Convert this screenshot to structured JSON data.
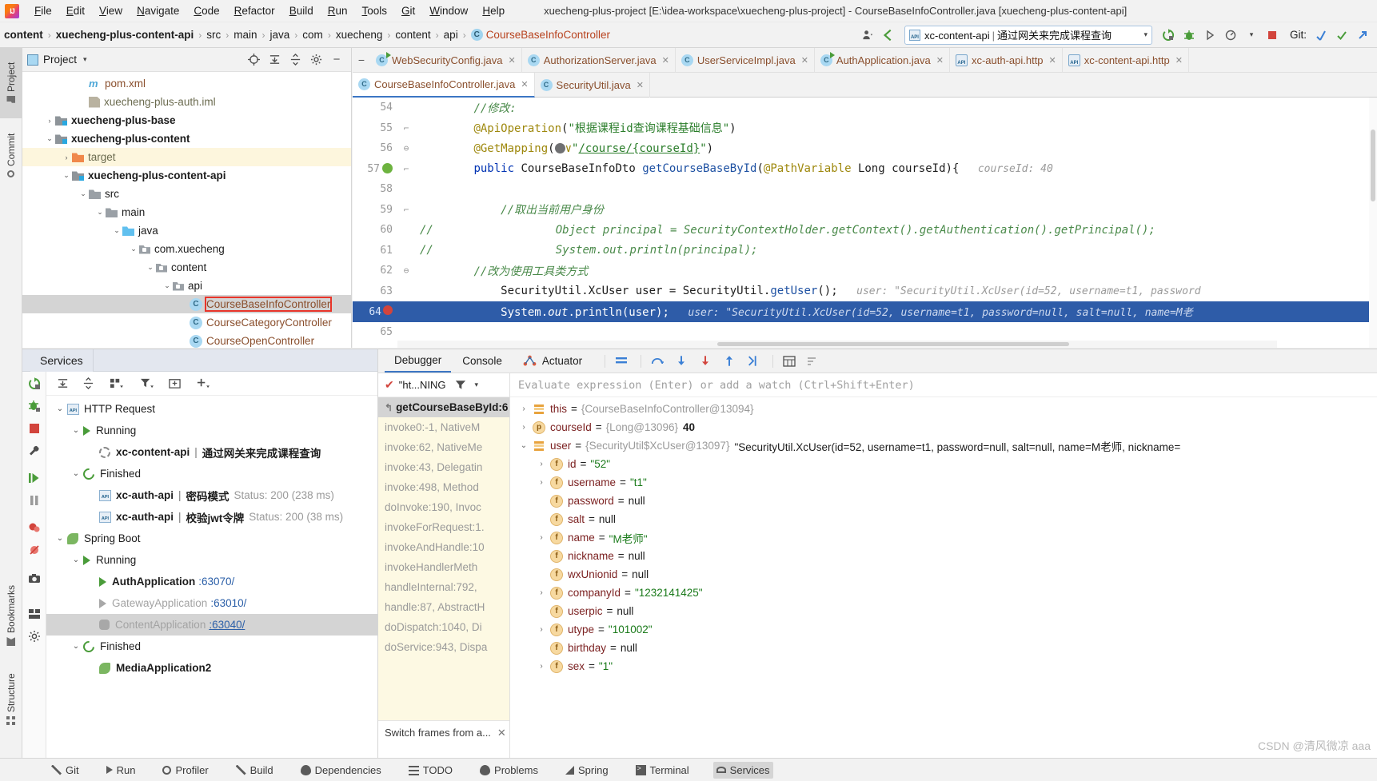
{
  "window": {
    "title": "xuecheng-plus-project [E:\\idea-workspace\\xuecheng-plus-project] - CourseBaseInfoController.java [xuecheng-plus-content-api]"
  },
  "menu": {
    "items": [
      "File",
      "Edit",
      "View",
      "Navigate",
      "Code",
      "Refactor",
      "Build",
      "Run",
      "Tools",
      "Git",
      "Window",
      "Help"
    ]
  },
  "breadcrumb": {
    "items": [
      {
        "label": "content",
        "bold": true
      },
      {
        "label": "xuecheng-plus-content-api",
        "bold": true
      },
      {
        "label": "src",
        "bold": false
      },
      {
        "label": "main",
        "bold": false
      },
      {
        "label": "java",
        "bold": false
      },
      {
        "label": "com",
        "bold": false
      },
      {
        "label": "xuecheng",
        "bold": false
      },
      {
        "label": "content",
        "bold": false
      },
      {
        "label": "api",
        "bold": false
      }
    ],
    "class_name": "CourseBaseInfoController",
    "class_icon": "C"
  },
  "run_config": {
    "name": "xc-content-api",
    "separator": "|",
    "description": "通过网关来完成课程查询",
    "dropdown_caret": "▾"
  },
  "git_label": "Git:",
  "tool_strip": {
    "left": [
      "Project",
      "Commit",
      "Bookmarks",
      "Structure"
    ]
  },
  "project_panel": {
    "title": "Project",
    "dropdown": "▾",
    "tree": [
      {
        "indent": 3,
        "arrow": "",
        "icon": "maven",
        "label": "pom.xml",
        "style": "brown"
      },
      {
        "indent": 3,
        "arrow": "",
        "icon": "iml",
        "label": "xuecheng-plus-auth.iml",
        "style": "mute"
      },
      {
        "indent": 1,
        "arrow": "›",
        "icon": "module",
        "label": "xuecheng-plus-base",
        "style": "bold"
      },
      {
        "indent": 1,
        "arrow": "⌄",
        "icon": "module",
        "label": "xuecheng-plus-content",
        "style": "bold"
      },
      {
        "indent": 2,
        "arrow": "›",
        "icon": "orange-folder",
        "label": "target",
        "style": "mute",
        "highlight": true
      },
      {
        "indent": 2,
        "arrow": "⌄",
        "icon": "module",
        "label": "xuecheng-plus-content-api",
        "style": "bold"
      },
      {
        "indent": 3,
        "arrow": "⌄",
        "icon": "folder",
        "label": "src",
        "style": ""
      },
      {
        "indent": 4,
        "arrow": "⌄",
        "icon": "folder",
        "label": "main",
        "style": ""
      },
      {
        "indent": 5,
        "arrow": "⌄",
        "icon": "blue-folder",
        "label": "java",
        "style": ""
      },
      {
        "indent": 6,
        "arrow": "⌄",
        "icon": "package",
        "label": "com.xuecheng",
        "style": ""
      },
      {
        "indent": 7,
        "arrow": "⌄",
        "icon": "package",
        "label": "content",
        "style": ""
      },
      {
        "indent": 8,
        "arrow": "⌄",
        "icon": "package",
        "label": "api",
        "style": ""
      },
      {
        "indent": 9,
        "arrow": "",
        "icon": "class",
        "label": "CourseBaseInfoController",
        "style": "brown",
        "selected": true,
        "redbox": true
      },
      {
        "indent": 9,
        "arrow": "",
        "icon": "class",
        "label": "CourseCategoryController",
        "style": "brown"
      },
      {
        "indent": 9,
        "arrow": "",
        "icon": "class",
        "label": "CourseOpenController",
        "style": "brown"
      }
    ]
  },
  "editor": {
    "tabs_row1": [
      {
        "label": "WebSecurityConfig.java",
        "icon": "class-run"
      },
      {
        "label": "AuthorizationServer.java",
        "icon": "class"
      },
      {
        "label": "UserServiceImpl.java",
        "icon": "class"
      },
      {
        "label": "AuthApplication.java",
        "icon": "class-run"
      },
      {
        "label": "xc-auth-api.http",
        "icon": "http"
      },
      {
        "label": "xc-content-api.http",
        "icon": "http"
      }
    ],
    "tabs_row2": [
      {
        "label": "CourseBaseInfoController.java",
        "icon": "class",
        "active": true
      },
      {
        "label": "SecurityUtil.java",
        "icon": "class"
      }
    ],
    "lines": [
      {
        "num": "54",
        "fold": "",
        "gutter_hl": false,
        "content_html": "        <span class='cmt'>//修改:</span>"
      },
      {
        "num": "55",
        "fold": "⌐",
        "gutter_hl": false,
        "content_html": "        <span class='ann'>@ApiOperation</span>(<span class='str'>\"根据课程id查询课程基础信息\"</span>)"
      },
      {
        "num": "56",
        "fold": "⊖",
        "gutter_hl": false,
        "content_html": "        <span class='ann'>@GetMapping</span>(<span class='globe'></span><span class='ann'>∨</span><span class='str'>\"</span><span class='lnk'>/course/{courseId}</span><span class='str'>\"</span>)"
      },
      {
        "num": "57",
        "fold": "⌐",
        "gutter_hl": false,
        "marker": "spring",
        "content_html": "        <span class='kw'>public</span> <span class='typ'>CourseBaseInfoDto</span> <span class='mth'>getCourseBaseById</span>(<span class='ann'>@PathVariable</span> <span class='typ'>Long</span> courseId){<span class='hint'>   courseId: 40</span>"
      },
      {
        "num": "58",
        "fold": "",
        "gutter_hl": false,
        "content_html": ""
      },
      {
        "num": "59",
        "fold": "⌐",
        "gutter_hl": false,
        "content_html": "            <span class='cmt'>//取出当前用户身份</span>"
      },
      {
        "num": "60",
        "fold": "",
        "gutter_hl": false,
        "prefix": "//",
        "content_html": "            <span class='cmt'>    Object principal = SecurityContextHolder.getContext().getAuthentication().getPrincipal();</span>"
      },
      {
        "num": "61",
        "fold": "",
        "gutter_hl": false,
        "prefix": "//",
        "content_html": "            <span class='cmt'>    System.out.println(principal);</span>"
      },
      {
        "num": "62",
        "fold": "⊖",
        "gutter_hl": false,
        "content_html": "        <span class='cmt'>//改为使用工具类方式</span>"
      },
      {
        "num": "63",
        "fold": "",
        "gutter_hl": false,
        "content_html": "            <span class='typ'>SecurityUtil.XcUser</span> user = <span class='typ'>SecurityUtil</span>.<span class='mth'>getUser</span>();<span class='hint'>   user: \"SecurityUtil.XcUser(id=52, username=t1, password</span>"
      },
      {
        "num": "64",
        "fold": "",
        "gutter_hl": true,
        "marker": "breakpoint",
        "content_html": "            System.<span style='font-style:italic'>out</span>.println(user);<span class='hint'>   user: \"SecurityUtil.XcUser(id=52, username=t1, password=null, salt=null, name=M老</span>"
      },
      {
        "num": "65",
        "fold": "",
        "gutter_hl": false,
        "content_html": ""
      }
    ]
  },
  "services": {
    "panel_title": "Services",
    "tree": [
      {
        "indent": 0,
        "arrow": "⌄",
        "icon": "api",
        "label": "HTTP Request",
        "style": ""
      },
      {
        "indent": 1,
        "arrow": "⌄",
        "icon": "play",
        "label": "Running",
        "style": ""
      },
      {
        "indent": 2,
        "arrow": "",
        "icon": "spin",
        "label": "xc-content-api",
        "sep": "|",
        "label2": "通过网关来完成课程查询",
        "style": "bold"
      },
      {
        "indent": 1,
        "arrow": "⌄",
        "icon": "rerun",
        "label": "Finished",
        "style": ""
      },
      {
        "indent": 2,
        "arrow": "",
        "icon": "api",
        "label": "xc-auth-api",
        "sep": "|",
        "label2": "密码模式",
        "status": "Status: 200 (238 ms)",
        "style": "bold"
      },
      {
        "indent": 2,
        "arrow": "",
        "icon": "api",
        "label": "xc-auth-api",
        "sep": "|",
        "label2": "校验jwt令牌",
        "status": "Status: 200 (38 ms)",
        "style": "bold"
      },
      {
        "indent": 0,
        "arrow": "⌄",
        "icon": "leaf",
        "label": "Spring Boot",
        "style": ""
      },
      {
        "indent": 1,
        "arrow": "⌄",
        "icon": "play",
        "label": "Running",
        "style": ""
      },
      {
        "indent": 2,
        "arrow": "",
        "icon": "play",
        "label": "AuthApplication",
        "port": ":63070/",
        "style": "bold"
      },
      {
        "indent": 2,
        "arrow": "",
        "icon": "play-grey",
        "label": "GatewayApplication",
        "port": ":63010/",
        "style": "dim"
      },
      {
        "indent": 2,
        "arrow": "",
        "icon": "bug",
        "label": "ContentApplication",
        "port": ":63040/",
        "style": "dim",
        "selected": true,
        "port_link": true
      },
      {
        "indent": 1,
        "arrow": "⌄",
        "icon": "rerun",
        "label": "Finished",
        "style": ""
      },
      {
        "indent": 2,
        "arrow": "",
        "icon": "leaf",
        "label": "MediaApplication2",
        "style": "bold"
      }
    ]
  },
  "debugger": {
    "tabs": [
      "Debugger",
      "Console",
      "Actuator"
    ],
    "active_tab": "Debugger",
    "thread_label": "\"ht...NING",
    "frames": [
      {
        "label": "getCourseBaseById:6",
        "selected": true
      },
      {
        "label": "invoke0:-1, NativeM"
      },
      {
        "label": "invoke:62, NativeMe"
      },
      {
        "label": "invoke:43, Delegatin"
      },
      {
        "label": "invoke:498, Method"
      },
      {
        "label": "doInvoke:190, Invoc"
      },
      {
        "label": "invokeForRequest:1."
      },
      {
        "label": "invokeAndHandle:10"
      },
      {
        "label": "invokeHandlerMeth"
      },
      {
        "label": "handleInternal:792, "
      },
      {
        "label": "handle:87, AbstractH"
      },
      {
        "label": "doDispatch:1040, Di"
      },
      {
        "label": "doService:943, Dispa"
      }
    ],
    "frames_footer": "Switch frames from a...",
    "evaluate_placeholder": "Evaluate expression (Enter) or add a watch (Ctrl+Shift+Enter)",
    "variables": [
      {
        "indent": 0,
        "arrow": "›",
        "icon": "obj",
        "name": "this",
        "ref": "{CourseBaseInfoController@13094}",
        "value": "",
        "value_type": "none"
      },
      {
        "indent": 0,
        "arrow": "›",
        "icon": "p",
        "name": "courseId",
        "ref": "{Long@13096}",
        "value": "40",
        "value_type": "num"
      },
      {
        "indent": 0,
        "arrow": "⌄",
        "icon": "obj",
        "name": "user",
        "ref": "{SecurityUtil$XcUser@13097}",
        "value": "\"SecurityUtil.XcUser(id=52, username=t1, password=null, salt=null, name=M老师, nickname=",
        "value_type": "plain"
      },
      {
        "indent": 1,
        "arrow": "›",
        "icon": "f",
        "name": "id",
        "ref": "",
        "value": "\"52\"",
        "value_type": "str"
      },
      {
        "indent": 1,
        "arrow": "›",
        "icon": "f",
        "name": "username",
        "ref": "",
        "value": "\"t1\"",
        "value_type": "str"
      },
      {
        "indent": 1,
        "arrow": "",
        "icon": "f",
        "name": "password",
        "ref": "",
        "value": "null",
        "value_type": "null"
      },
      {
        "indent": 1,
        "arrow": "",
        "icon": "f",
        "name": "salt",
        "ref": "",
        "value": "null",
        "value_type": "null"
      },
      {
        "indent": 1,
        "arrow": "›",
        "icon": "f",
        "name": "name",
        "ref": "",
        "value": "\"M老师\"",
        "value_type": "str"
      },
      {
        "indent": 1,
        "arrow": "",
        "icon": "f",
        "name": "nickname",
        "ref": "",
        "value": "null",
        "value_type": "null"
      },
      {
        "indent": 1,
        "arrow": "",
        "icon": "f",
        "name": "wxUnionid",
        "ref": "",
        "value": "null",
        "value_type": "null"
      },
      {
        "indent": 1,
        "arrow": "›",
        "icon": "f",
        "name": "companyId",
        "ref": "",
        "value": "\"1232141425\"",
        "value_type": "str"
      },
      {
        "indent": 1,
        "arrow": "",
        "icon": "f",
        "name": "userpic",
        "ref": "",
        "value": "null",
        "value_type": "null"
      },
      {
        "indent": 1,
        "arrow": "›",
        "icon": "f",
        "name": "utype",
        "ref": "",
        "value": "\"101002\"",
        "value_type": "str"
      },
      {
        "indent": 1,
        "arrow": "",
        "icon": "f",
        "name": "birthday",
        "ref": "",
        "value": "null",
        "value_type": "null"
      },
      {
        "indent": 1,
        "arrow": "›",
        "icon": "f",
        "name": "sex",
        "ref": "",
        "value": "\"1\"",
        "value_type": "str"
      }
    ]
  },
  "statusbar": {
    "items": [
      {
        "label": "Git",
        "icon": "git-icon"
      },
      {
        "label": "Run",
        "icon": "run-icon"
      },
      {
        "label": "Profiler",
        "icon": "profiler-icon"
      },
      {
        "label": "Build",
        "icon": "build-icon"
      },
      {
        "label": "Dependencies",
        "icon": "dependencies-icon"
      },
      {
        "label": "TODO",
        "icon": "todo-icon"
      },
      {
        "label": "Problems",
        "icon": "problems-icon"
      },
      {
        "label": "Spring",
        "icon": "spring-icon"
      },
      {
        "label": "Terminal",
        "icon": "terminal-icon"
      },
      {
        "label": "Services",
        "icon": "services-icon",
        "active": true
      }
    ]
  },
  "watermark": "CSDN @清风微凉 aaa"
}
